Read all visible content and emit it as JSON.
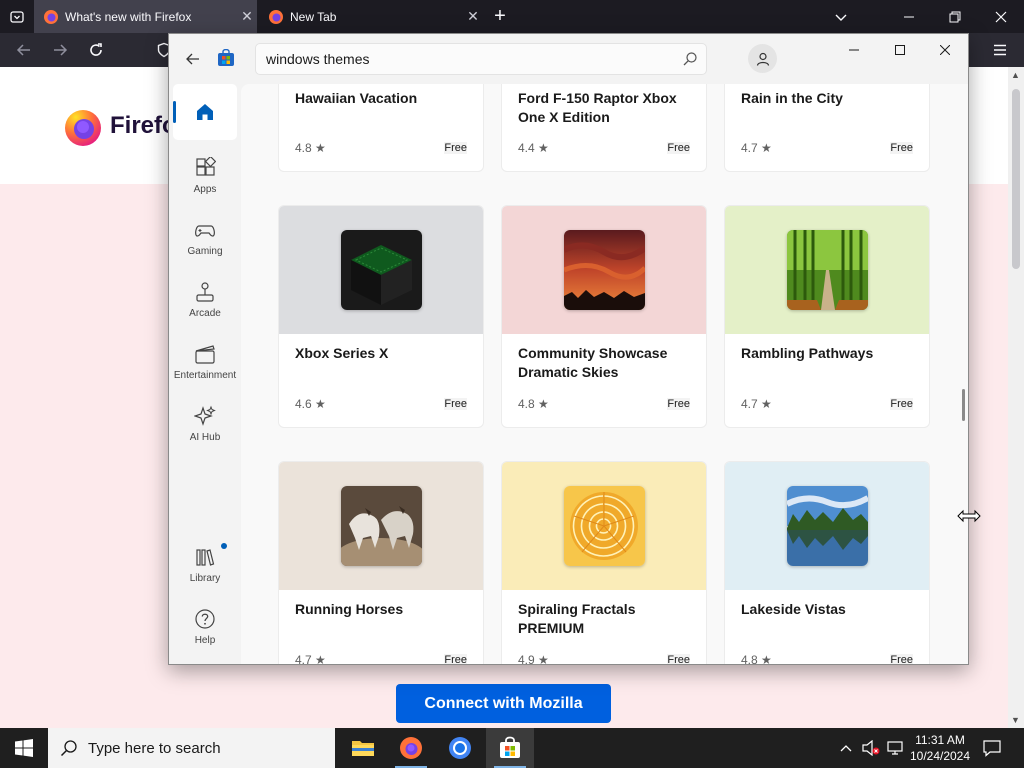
{
  "firefox": {
    "tabs": [
      {
        "title": "What's new with Firefox"
      },
      {
        "title": "New Tab"
      }
    ],
    "page": {
      "brand_word": "Firefox",
      "connect_button": "Connect with Mozilla"
    }
  },
  "store": {
    "search": {
      "value": "windows themes"
    },
    "sidebar": [
      {
        "label": ""
      },
      {
        "label": "Apps"
      },
      {
        "label": "Gaming"
      },
      {
        "label": "Arcade"
      },
      {
        "label": "Entertainment"
      },
      {
        "label": "AI Hub"
      },
      {
        "label": "Library"
      },
      {
        "label": "Help"
      }
    ],
    "cards": [
      {
        "name": "Hawaiian Vacation",
        "rating": "4.8 ★",
        "price": "Free"
      },
      {
        "name": "Ford F-150 Raptor Xbox One X Edition",
        "rating": "4.4 ★",
        "price": "Free"
      },
      {
        "name": "Rain in the City",
        "rating": "4.7 ★",
        "price": "Free"
      },
      {
        "name": "Xbox Series X",
        "rating": "4.6 ★",
        "price": "Free"
      },
      {
        "name": "Community Showcase Dramatic Skies",
        "rating": "4.8 ★",
        "price": "Free"
      },
      {
        "name": "Rambling Pathways",
        "rating": "4.7 ★",
        "price": "Free"
      },
      {
        "name": "Running Horses",
        "rating": "4.7 ★",
        "price": "Free"
      },
      {
        "name": "Spiraling Fractals PREMIUM",
        "rating": "4.9 ★",
        "price": "Free"
      },
      {
        "name": "Lakeside Vistas",
        "rating": "4.8 ★",
        "price": "Free"
      }
    ]
  },
  "taskbar": {
    "search_placeholder": "Type here to search",
    "time": "11:31 AM",
    "date": "10/24/2024"
  },
  "colors": {
    "firefox_dark": "#1c1b22",
    "mozilla_blue": "#0060df",
    "store_accent": "#005fb8"
  }
}
